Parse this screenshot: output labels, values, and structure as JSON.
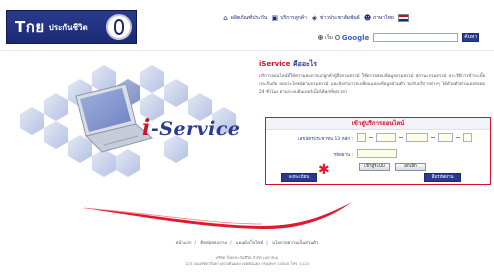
{
  "header": {
    "logo_main": "Tกย",
    "logo_sub": "ประกันชีวิต",
    "nav": [
      {
        "label": "ผลิตภัณฑ์ประกัน",
        "icon": "house-icon"
      },
      {
        "label": "บริการลูกค้า",
        "icon": "building-icon"
      },
      {
        "label": "ข่าวประชาสัมพันธ์",
        "icon": "megaphone-icon"
      },
      {
        "label": "ภาษาไทย",
        "icon": "person-icon"
      }
    ],
    "search": {
      "option_site": "เว็บ",
      "option_google": "Google",
      "placeholder": "",
      "button_label": "ค้นหา"
    }
  },
  "hero": {
    "brand_i": "i",
    "brand_rest": "-Service"
  },
  "content": {
    "title_red": "iService",
    "title_blue": "คืออะไร",
    "intro": "บริการออนไลน์ที่ให้ความสะดวกแก่ลูกค้าผู้ถือกรมธรรม์ ใช้ตรวจสอบข้อมูลกรมธรรม์ สถานะกรมธรรม์ ประวัติการชำระเบี้ยประกันภัย ผลประโยชน์ตามกรมธรรม์ และยังสามารถเปลี่ยนแปลงข้อมูลส่วนตัว ขอรับบริการต่างๆ ได้ด้วยตัวท่านเองตลอด 24 ชั่วโมง ผ่านระบบอินเทอร์เน็ตได้ทุกที่ทุกเวลา"
  },
  "login": {
    "header": "เข้าสู่บริการออนไลน์",
    "id_label": "เลขบัตรประชาชน 13 หลัก :",
    "password_label": "รหัสผ่าน :",
    "login_button": "เข้าสู่ระบบ",
    "cancel_button": "ยกเลิก",
    "register_button": "ลงทะเบียน",
    "forgot_button": "ลืมรหัสผ่าน"
  },
  "footer": {
    "links": [
      "หน้าแรก",
      "ติดต่อสอบถาม",
      "แผนผังเว็บไซต์",
      "นโยบายความเป็นส่วนตัว"
    ],
    "address_line1": "บริษัท ไทยประกันชีวิต จำกัด (มหาชน)",
    "address_line2": "123 ถนนรัชดาภิเษก แขวงดินแดง เขตดินแดง กรุงเทพฯ 10400 โทร. 1124"
  },
  "colors": {
    "brand_blue": "#2a3b8f",
    "accent_red": "#d5102a"
  }
}
